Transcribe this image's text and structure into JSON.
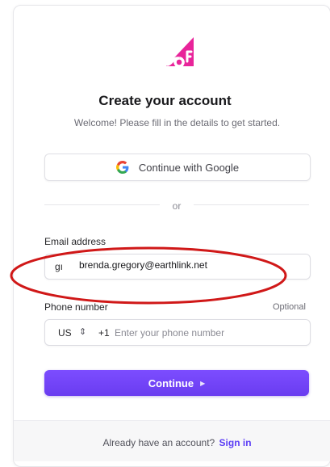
{
  "header": {
    "logo_icon": "brand-logo-icon",
    "title": "Create your account",
    "subtitle": "Welcome! Please fill in the details to get started."
  },
  "oauth": {
    "google_label": "Continue with Google",
    "google_icon": "google-icon"
  },
  "divider": {
    "text": "or"
  },
  "email": {
    "label": "Email address",
    "value_partial": "gı",
    "overlay_text": "brenda.gregory@earthlink.net"
  },
  "phone": {
    "label": "Phone number",
    "optional_text": "Optional",
    "country": "US",
    "code": "+1",
    "placeholder": "Enter your phone number"
  },
  "continue": {
    "label": "Continue",
    "arrow_icon": "play-arrow-icon"
  },
  "footer": {
    "prompt": "Already have an account?",
    "link": "Sign in"
  },
  "colors": {
    "brand_pink": "#e8249a",
    "accent": "#6f42f5",
    "annotation_red": "#d01818"
  }
}
